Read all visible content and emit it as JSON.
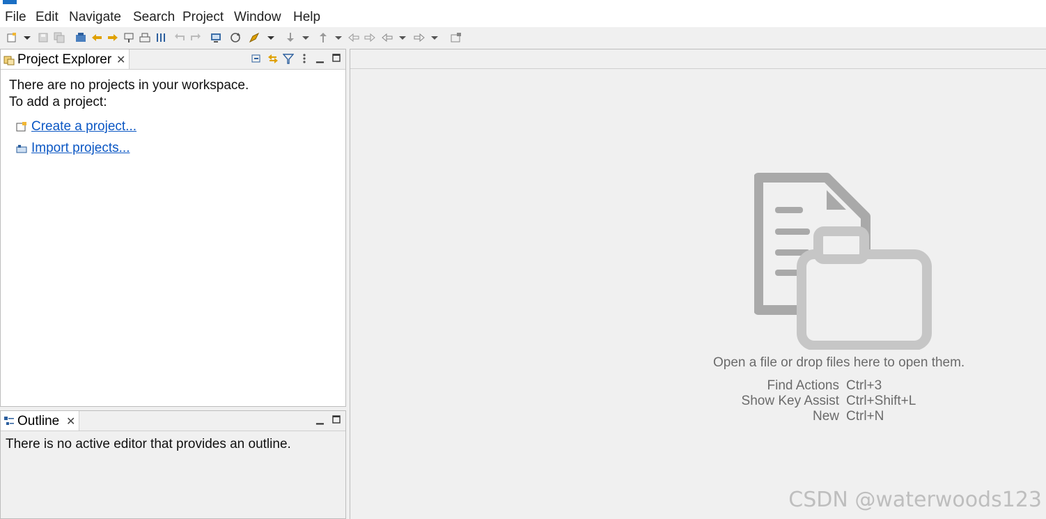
{
  "menu": [
    "File",
    "Edit",
    "Navigate",
    "Search",
    "Project",
    "Window",
    "Help"
  ],
  "project_explorer": {
    "tab_label": "Project Explorer",
    "message_line1": "There are no projects in your workspace.",
    "message_line2": "To add a project:",
    "create_link": "Create a project...",
    "import_link": "Import projects..."
  },
  "outline": {
    "tab_label": "Outline",
    "message": "There is no active editor that provides an outline."
  },
  "editor": {
    "empty_message": "Open a file or drop files here to open them.",
    "shortcuts": [
      {
        "action": "Find Actions",
        "key": "Ctrl+3"
      },
      {
        "action": "Show Key Assist",
        "key": "Ctrl+Shift+L"
      },
      {
        "action": "New",
        "key": "Ctrl+N"
      }
    ]
  },
  "watermark": "CSDN @waterwoods123",
  "colors": {
    "link": "#0b57c4",
    "hint": "#6b6b6b",
    "doc_icon": "#a9a9a9",
    "folder_icon": "#c6c6c6"
  }
}
